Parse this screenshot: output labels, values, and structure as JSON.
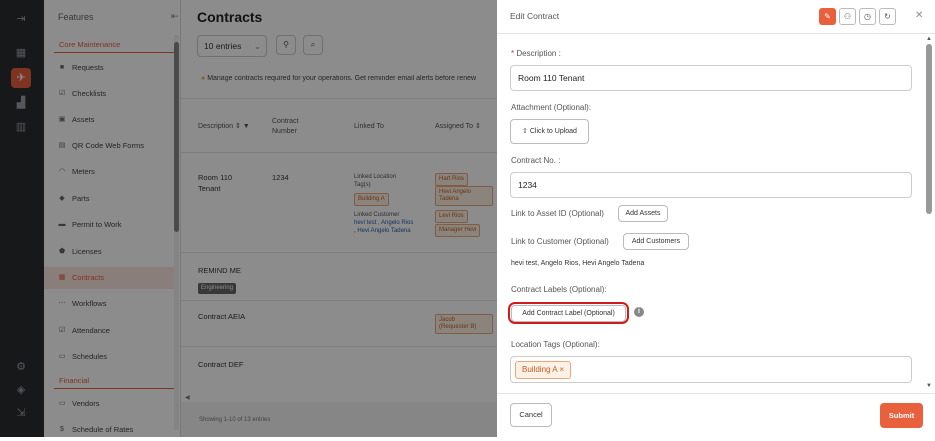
{
  "app": {
    "accent": "#e8603c"
  },
  "rail": {
    "icons": [
      "menu-icon",
      "grid-icon",
      "rocket-icon",
      "chart-icon",
      "bar-chart-icon",
      "gear-icon",
      "cube-icon",
      "logout-icon"
    ]
  },
  "sidebar": {
    "header": "Features",
    "section1": "Core Maintenance",
    "items": [
      {
        "label": "Requests"
      },
      {
        "label": "Checklists"
      },
      {
        "label": "Assets"
      },
      {
        "label": "QR Code Web Forms"
      },
      {
        "label": "Meters"
      },
      {
        "label": "Parts"
      },
      {
        "label": "Permit to Work"
      },
      {
        "label": "Licenses"
      },
      {
        "label": "Contracts"
      },
      {
        "label": "Workflows"
      },
      {
        "label": "Attendance"
      },
      {
        "label": "Schedules"
      }
    ],
    "section2": "Financial",
    "items2": [
      {
        "label": "Vendors"
      },
      {
        "label": "Schedule of Rates"
      }
    ]
  },
  "main": {
    "title": "Contracts",
    "entries": "10 entries",
    "notice": "Manage contracts required for your operations. Get reminder email alerts before renew",
    "columns": {
      "description": "Description",
      "contract_number_1": "Contract",
      "contract_number_2": "Number",
      "linked_to": "Linked To",
      "assigned_to": "Assigned To"
    },
    "rows": [
      {
        "desc1": "Room 110",
        "desc2": "Tenant",
        "number": "1234",
        "linked_location_1": "Linked Location",
        "linked_location_2": "Tag(s)",
        "location_tag": "Building A",
        "linked_customer": "Linked Customer",
        "customers_1": "hevi test , Angelo Rios",
        "customers_2": ", Hevi Angelo Tadena",
        "assignees": [
          "Hart Rios",
          "Hevi Angelo",
          "Tadena",
          "Levi Rios",
          "Manager Hevi"
        ]
      },
      {
        "desc1": "REMIND ME",
        "tag": "Engineering"
      },
      {
        "desc1": "Contract AEIA",
        "assignee_1": "Jacob",
        "assignee_2": "(Requester B)"
      },
      {
        "desc1": "Contract DEF"
      }
    ],
    "footer": "Showing 1-10 of 13 entries"
  },
  "panel": {
    "title": "Edit Contract",
    "description_label": "Description :",
    "description_value": "Room 110 Tenant",
    "attachment_label": "Attachment (Optional):",
    "upload_label": "Click to Upload",
    "contract_no_label": "Contract No. :",
    "contract_no_value": "1234",
    "asset_label": "Link to Asset ID (Optional)",
    "add_assets": "Add Assets",
    "customer_label": "Link to Customer (Optional)",
    "add_customers": "Add Customers",
    "customers_value": "hevi test, Angelo Rios, Hevi Angelo Tadena",
    "labels_label": "Contract Labels (Optional):",
    "add_label": "Add Contract Label (Optional)",
    "location_label": "Location Tags (Optional):",
    "location_chip": "Building A",
    "cancel": "Cancel",
    "submit": "Submit"
  }
}
